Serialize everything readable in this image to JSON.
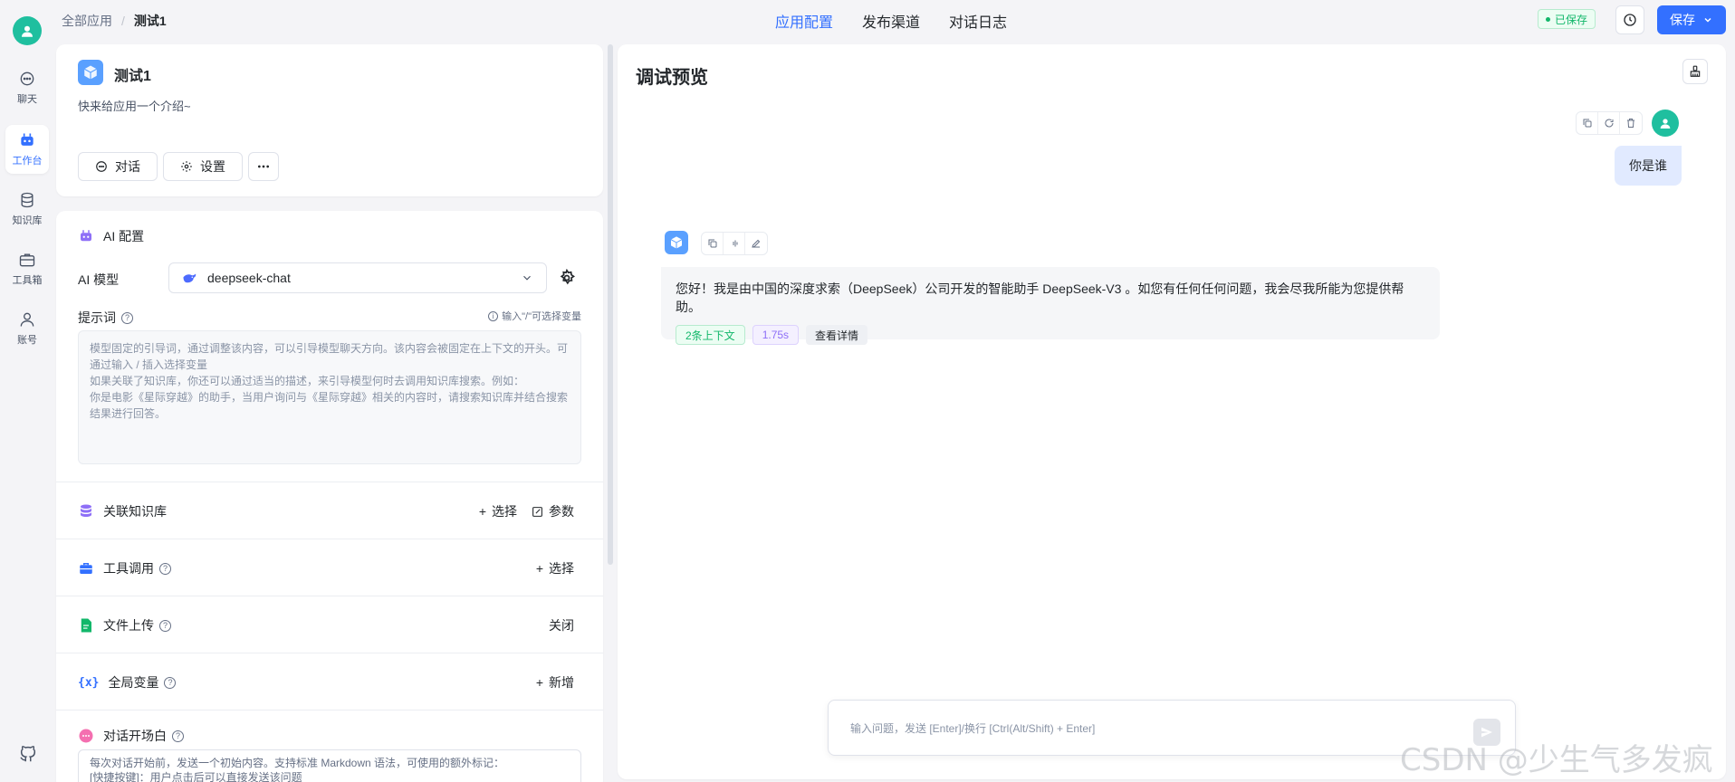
{
  "rail": {
    "items": [
      {
        "label": "聊天",
        "icon": "chat-icon"
      },
      {
        "label": "工作台",
        "icon": "robot-icon",
        "active": true
      },
      {
        "label": "知识库",
        "icon": "database-icon"
      },
      {
        "label": "工具箱",
        "icon": "toolbox-icon"
      },
      {
        "label": "账号",
        "icon": "user-icon"
      }
    ]
  },
  "breadcrumb": {
    "root": "全部应用",
    "current": "测试1"
  },
  "tabs": [
    {
      "label": "应用配置",
      "active": true
    },
    {
      "label": "发布渠道"
    },
    {
      "label": "对话日志"
    }
  ],
  "header": {
    "saved_status": "已保存",
    "save_label": "保存"
  },
  "app": {
    "name": "测试1",
    "intro": "快来给应用一个介绍~",
    "chat_button": "对话",
    "settings_button": "设置"
  },
  "ai_config": {
    "title": "AI 配置",
    "model_label": "AI 模型",
    "model_value": "deepseek-chat",
    "prompt_label": "提示词",
    "prompt_hint": "输入\"/\"可选择变量",
    "prompt_placeholder": "模型固定的引导词，通过调整该内容，可以引导模型聊天方向。该内容会被固定在上下文的开头。可通过输入 / 插入选择变量\n如果关联了知识库，你还可以通过适当的描述，来引导模型何时去调用知识库搜索。例如：\n你是电影《星际穿越》的助手，当用户询问与《星际穿越》相关的内容时，请搜索知识库并结合搜索结果进行回答。"
  },
  "sections": {
    "knowledge": {
      "title": "关联知识库",
      "select": "选择",
      "params": "参数"
    },
    "tools": {
      "title": "工具调用",
      "select": "选择"
    },
    "file_upload": {
      "title": "文件上传",
      "status": "关闭"
    },
    "variables": {
      "title": "全局变量",
      "add": "新增"
    },
    "opening": {
      "title": "对话开场白",
      "placeholder": "每次对话开始前，发送一个初始内容。支持标准 Markdown 语法，可使用的额外标记：\n[快捷按键]：用户点击后可以直接发送该问题"
    }
  },
  "preview": {
    "title": "调试预览",
    "user_message": "你是谁",
    "bot_message": "您好！我是由中国的深度求索（DeepSeek）公司开发的智能助手 DeepSeek-V3 。如您有任何任何问题，我会尽我所能为您提供帮助。",
    "tag_context": "2条上下文",
    "tag_time": "1.75s",
    "tag_detail": "查看详情",
    "input_placeholder": "输入问题，发送 [Enter]/换行 [Ctrl(Alt/Shift) + Enter]"
  },
  "watermark": "CSDN @少生气多发疯",
  "colors": {
    "accent": "#3370ff",
    "avatar": "#1fbf9f",
    "success": "#12b76a"
  }
}
